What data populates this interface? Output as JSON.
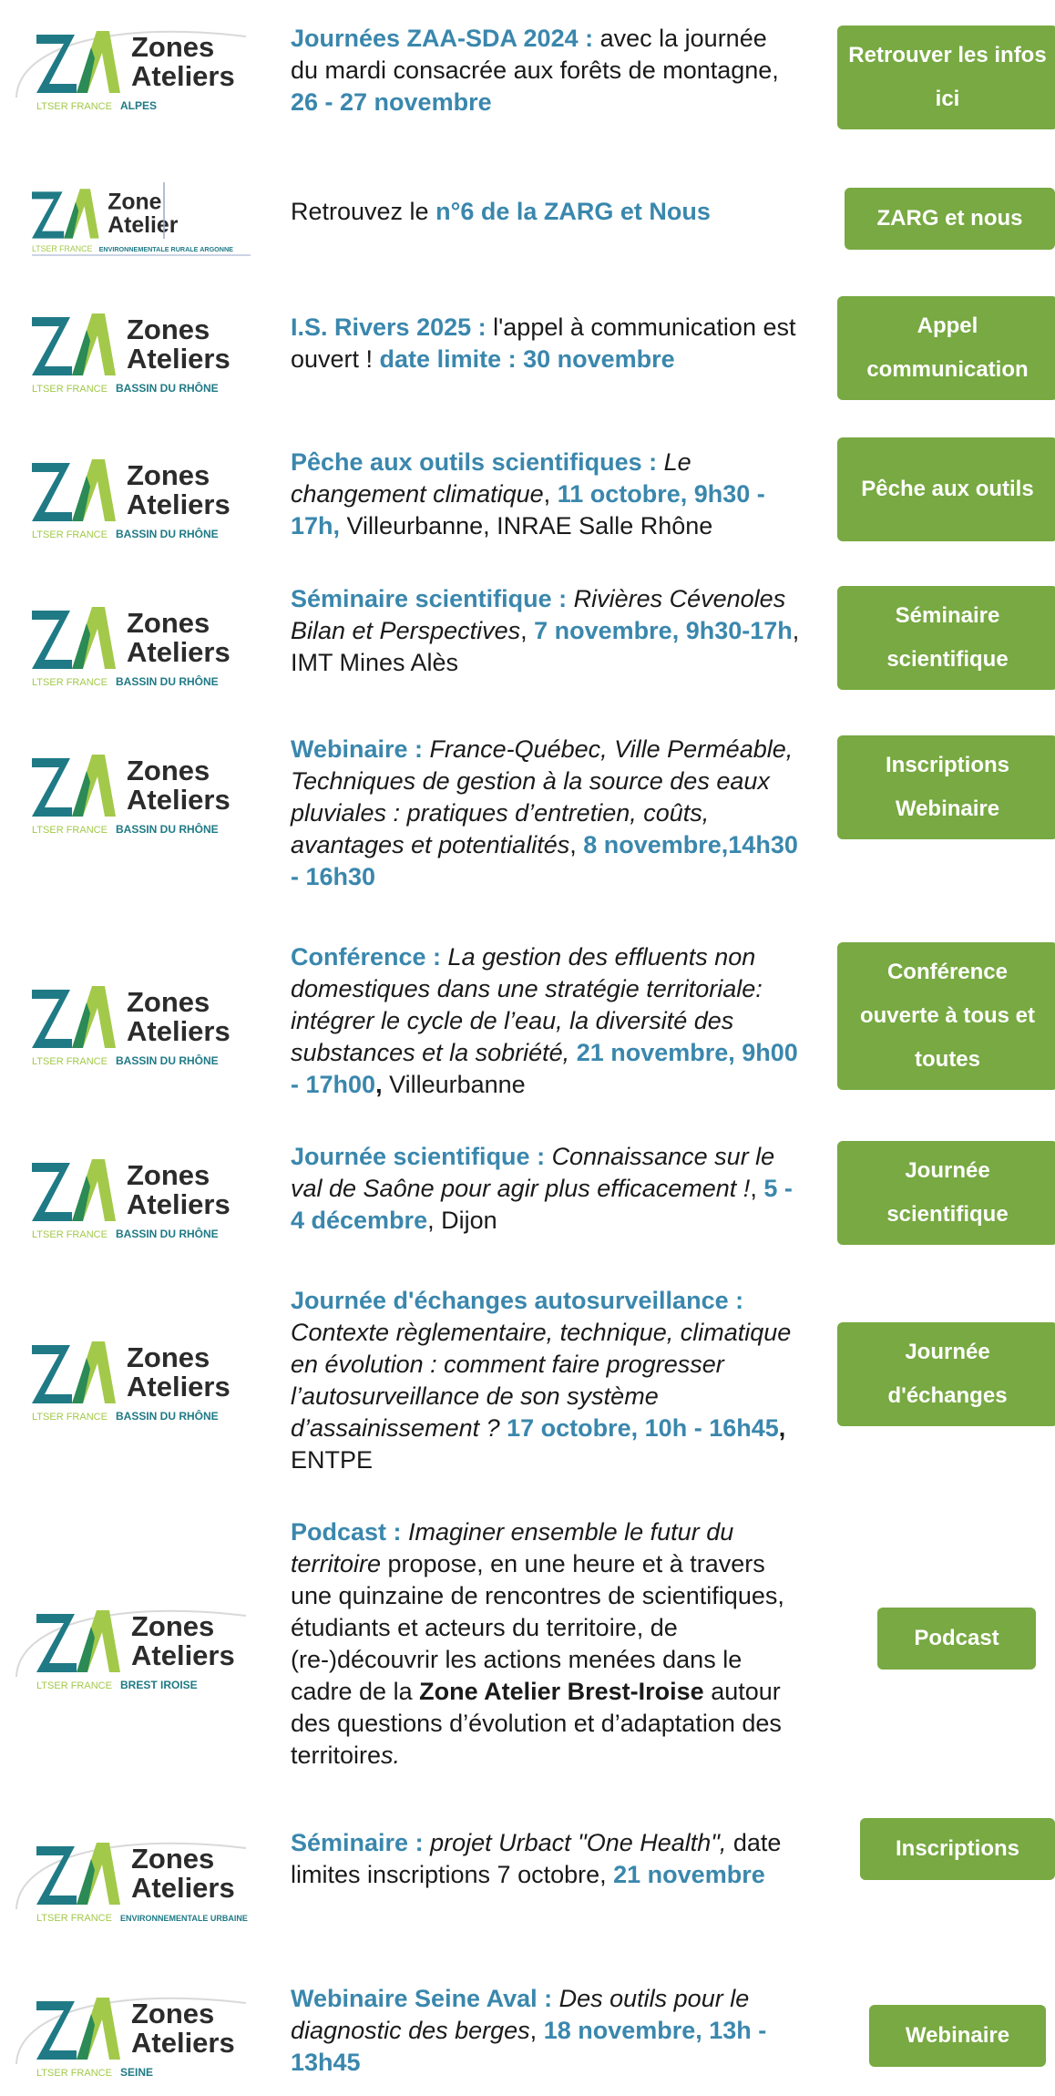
{
  "colors": {
    "accent_text": "#3a87ad",
    "button_bg": "#78a942",
    "button_text": "#ffffff",
    "logo_green_dark": "#2b8a55",
    "logo_green_light": "#a3c94a",
    "logo_teal": "#1f7a86"
  },
  "items": [
    {
      "logo": {
        "line1": "Zones",
        "line2": "Ateliers",
        "left": "LTSER FRANCE",
        "right": "ALPES",
        "variant": "alpes"
      },
      "parts": [
        {
          "t": "Journées ZAA-SDA 2024 :",
          "s": "b"
        },
        {
          "t": " avec la journée du mardi consacrée aux forêts de montagne, ",
          "s": ""
        },
        {
          "t": "26 - 27 novembre",
          "s": "b"
        }
      ],
      "button": "Retrouver les infos ici"
    },
    {
      "logo": {
        "line1": "Zone",
        "line2": "Atelier",
        "left": "LTSER FRANCE",
        "right": "ENVIRONNEMENTALE RURALE ARGONNE",
        "variant": "argonne"
      },
      "parts": [
        {
          "t": "Retrouvez le ",
          "s": ""
        },
        {
          "t": "n°6 de la ZARG et Nous",
          "s": "b"
        }
      ],
      "button": "ZARG et  nous"
    },
    {
      "logo": {
        "line1": "Zones",
        "line2": "Ateliers",
        "left": "LTSER FRANCE",
        "right": "BASSIN DU RHÔNE",
        "variant": "rhone"
      },
      "parts": [
        {
          "t": "I.S. Rivers 2025 :",
          "s": "b"
        },
        {
          "t": " l'appel à communication est ouvert ! ",
          "s": ""
        },
        {
          "t": "date limite : 30 novembre",
          "s": "b"
        }
      ],
      "button": "Appel communication"
    },
    {
      "logo": {
        "line1": "Zones",
        "line2": "Ateliers",
        "left": "LTSER FRANCE",
        "right": "BASSIN DU RHÔNE",
        "variant": "rhone"
      },
      "parts": [
        {
          "t": "Pêche aux outils scientifiques : ",
          "s": "b"
        },
        {
          "t": "Le changement climatique",
          "s": "i"
        },
        {
          "t": ", ",
          "s": ""
        },
        {
          "t": "11 octobre, 9h30 - 17h,",
          "s": "b"
        },
        {
          "t": " Villeurbanne, INRAE Salle Rhône",
          "s": ""
        }
      ],
      "button": "Pêche aux outils"
    },
    {
      "logo": {
        "line1": "Zones",
        "line2": "Ateliers",
        "left": "LTSER FRANCE",
        "right": "BASSIN DU RHÔNE",
        "variant": "rhone"
      },
      "parts": [
        {
          "t": "Séminaire scientifique : ",
          "s": "b"
        },
        {
          "t": "Rivières Cévenoles Bilan et Perspectives",
          "s": "i"
        },
        {
          "t": ", ",
          "s": ""
        },
        {
          "t": "7 novembre, 9h30-17h",
          "s": "b"
        },
        {
          "t": ", IMT Mines Alès",
          "s": ""
        }
      ],
      "button": "Séminaire scientifique"
    },
    {
      "logo": {
        "line1": "Zones",
        "line2": "Ateliers",
        "left": "LTSER FRANCE",
        "right": "BASSIN DU RHÔNE",
        "variant": "rhone"
      },
      "parts": [
        {
          "t": "Webinaire : ",
          "s": "b"
        },
        {
          "t": " France-Québec, Ville Perméable, Techniques de gestion à la source des eaux pluviales : pratiques d’entretien, coûts, avantages et potentialités",
          "s": "i"
        },
        {
          "t": ", ",
          "s": ""
        },
        {
          "t": "8 novembre,14h30 - 16h30",
          "s": "b"
        }
      ],
      "button": "Inscriptions Webinaire"
    },
    {
      "logo": {
        "line1": "Zones",
        "line2": "Ateliers",
        "left": "LTSER FRANCE",
        "right": "BASSIN DU RHÔNE",
        "variant": "rhone"
      },
      "parts": [
        {
          "t": "Conférence : ",
          "s": "b"
        },
        {
          "t": "La gestion des effluents non domestiques dans une stratégie territoriale: intégrer le cycle de l’eau, la diversité des substances et la sobriété, ",
          "s": "i"
        },
        {
          "t": "21 novembre, 9h00 - 17h00",
          "s": "b"
        },
        {
          "t": ",",
          "s": "bb"
        },
        {
          "t": " Villeurbanne",
          "s": ""
        }
      ],
      "button": "Conférence ouverte à tous et toutes"
    },
    {
      "logo": {
        "line1": "Zones",
        "line2": "Ateliers",
        "left": "LTSER FRANCE",
        "right": "BASSIN DU RHÔNE",
        "variant": "rhone"
      },
      "parts": [
        {
          "t": "Journée scientifique : ",
          "s": "b"
        },
        {
          "t": "Connaissance sur le val de Saône pour agir plus efficacement !",
          "s": "i"
        },
        {
          "t": ", ",
          "s": ""
        },
        {
          "t": "5 - 4 décembre",
          "s": "b"
        },
        {
          "t": ", Dijon",
          "s": ""
        }
      ],
      "button": "Journée scientifique"
    },
    {
      "logo": {
        "line1": "Zones",
        "line2": "Ateliers",
        "left": "LTSER FRANCE",
        "right": "BASSIN DU RHÔNE",
        "variant": "rhone"
      },
      "parts": [
        {
          "t": "Journée d'échanges autosurveillance : ",
          "s": "b"
        },
        {
          "t": "Contexte règlementaire, technique, climatique en évolution : comment faire progresser l’autosurveillance de son système d’assainissement ? ",
          "s": "i"
        },
        {
          "t": "17 octobre, 10h - 16h45",
          "s": "b"
        },
        {
          "t": ",",
          "s": "bb"
        },
        {
          "t": " ENTPE",
          "s": ""
        }
      ],
      "button": "Journée d'échanges"
    },
    {
      "logo": {
        "line1": "Zones",
        "line2": "Ateliers",
        "left": "LTSER FRANCE",
        "right": "BREST IROISE",
        "variant": "brest"
      },
      "parts": [
        {
          "t": "Podcast : ",
          "s": "b"
        },
        {
          "t": "Imaginer ensemble le futur du territoire",
          "s": "i"
        },
        {
          "t": " propose, en une heure et à travers une quinzaine de rencontres de scientifiques, étudiants et acteurs du territoire, de (re-)découvrir les actions menées dans le cadre de la ",
          "s": ""
        },
        {
          "t": "Zone Atelier Brest-Iroise",
          "s": "bb"
        },
        {
          "t": " autour des questions d’évolution et d’adaptation des territoire",
          "s": ""
        },
        {
          "t": "s.",
          "s": "i"
        }
      ],
      "button": "Podcast"
    },
    {
      "logo": {
        "line1": "Zones",
        "line2": "Ateliers",
        "left": "LTSER FRANCE",
        "right": "ENVIRONNEMENTALE URBAINE",
        "variant": "urbaine"
      },
      "parts": [
        {
          "t": "Séminaire : ",
          "s": "b"
        },
        {
          "t": "projet Urbact \"One Health\",",
          "s": "i"
        },
        {
          "t": " date limites inscriptions 7 octobre, ",
          "s": ""
        },
        {
          "t": "21 novembre",
          "s": "b"
        }
      ],
      "button": "Inscriptions"
    },
    {
      "logo": {
        "line1": "Zones",
        "line2": "Ateliers",
        "left": "LTSER FRANCE",
        "right": "SEINE",
        "variant": "seine"
      },
      "parts": [
        {
          "t": "Webinaire Seine Aval : ",
          "s": "b"
        },
        {
          "t": "Des outils pour le diagnostic des berges",
          "s": "i"
        },
        {
          "t": ", ",
          "s": ""
        },
        {
          "t": "18 novembre, 13h - 13h45",
          "s": "b"
        }
      ],
      "button": "Webinaire"
    }
  ]
}
